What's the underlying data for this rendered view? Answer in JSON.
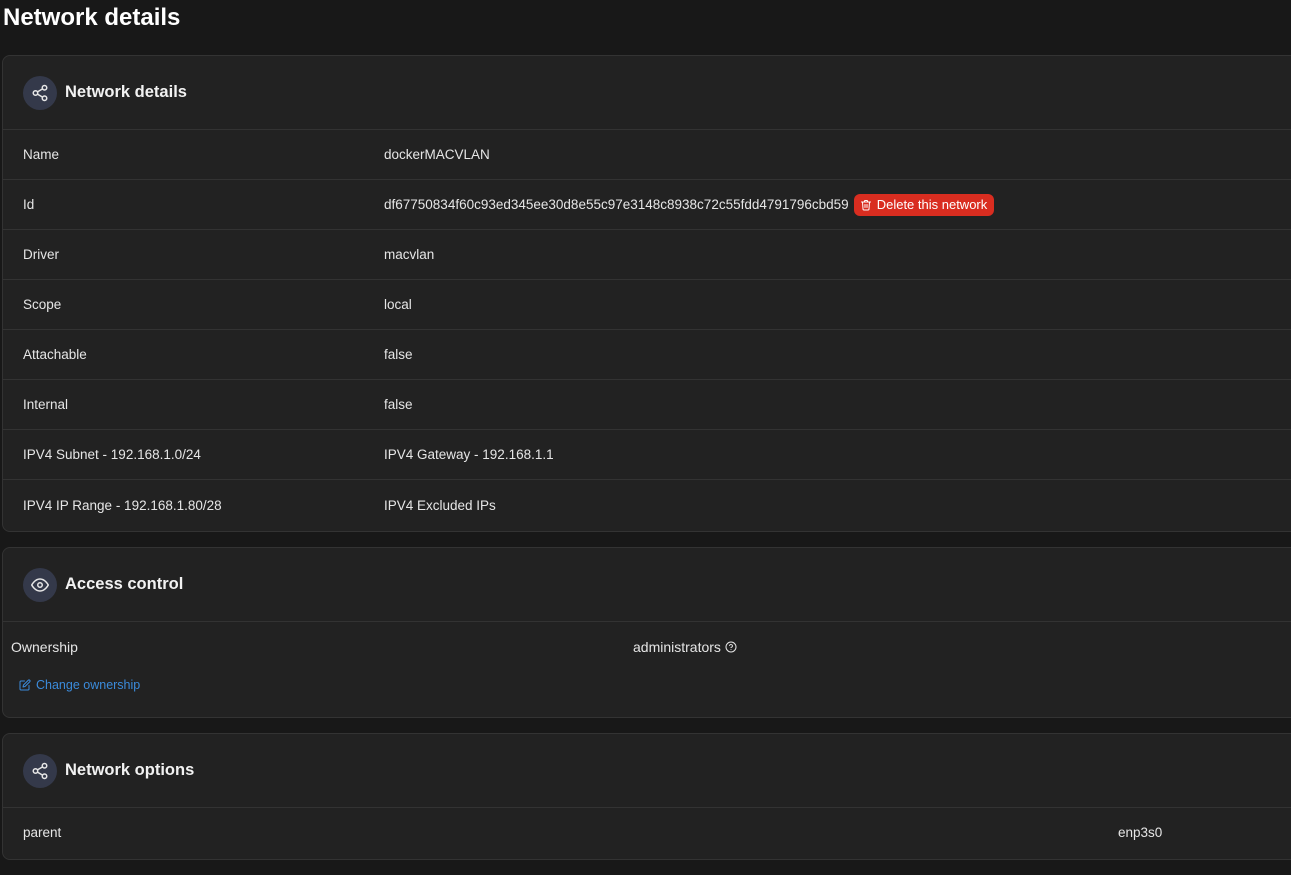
{
  "page": {
    "title": "Network details"
  },
  "details": {
    "title": "Network details",
    "icon": "share-icon",
    "rows": [
      {
        "key": "Name",
        "value": "dockerMACVLAN"
      },
      {
        "key": "Id",
        "value": "df67750834f60c93ed345ee30d8e55c97e3148c8938c72c55fdd4791796cbd59"
      },
      {
        "key": "Driver",
        "value": "macvlan"
      },
      {
        "key": "Scope",
        "value": "local"
      },
      {
        "key": "Attachable",
        "value": "false"
      },
      {
        "key": "Internal",
        "value": "false"
      },
      {
        "key": "IPV4 Subnet - 192.168.1.0/24",
        "value": "IPV4 Gateway - 192.168.1.1"
      },
      {
        "key": "IPV4 IP Range - 192.168.1.80/28",
        "value": "IPV4 Excluded IPs"
      }
    ],
    "delete_label": "Delete this network"
  },
  "access": {
    "title": "Access control",
    "icon": "eye-icon",
    "ownership_label": "Ownership",
    "ownership_value": "administrators",
    "change_label": "Change ownership"
  },
  "options": {
    "title": "Network options",
    "icon": "share-icon",
    "rows": [
      {
        "key": "parent",
        "value": "enp3s0"
      }
    ]
  },
  "colors": {
    "accent": "#3b8bdb",
    "danger": "#d92d20",
    "icon_bg": "#34394a"
  }
}
